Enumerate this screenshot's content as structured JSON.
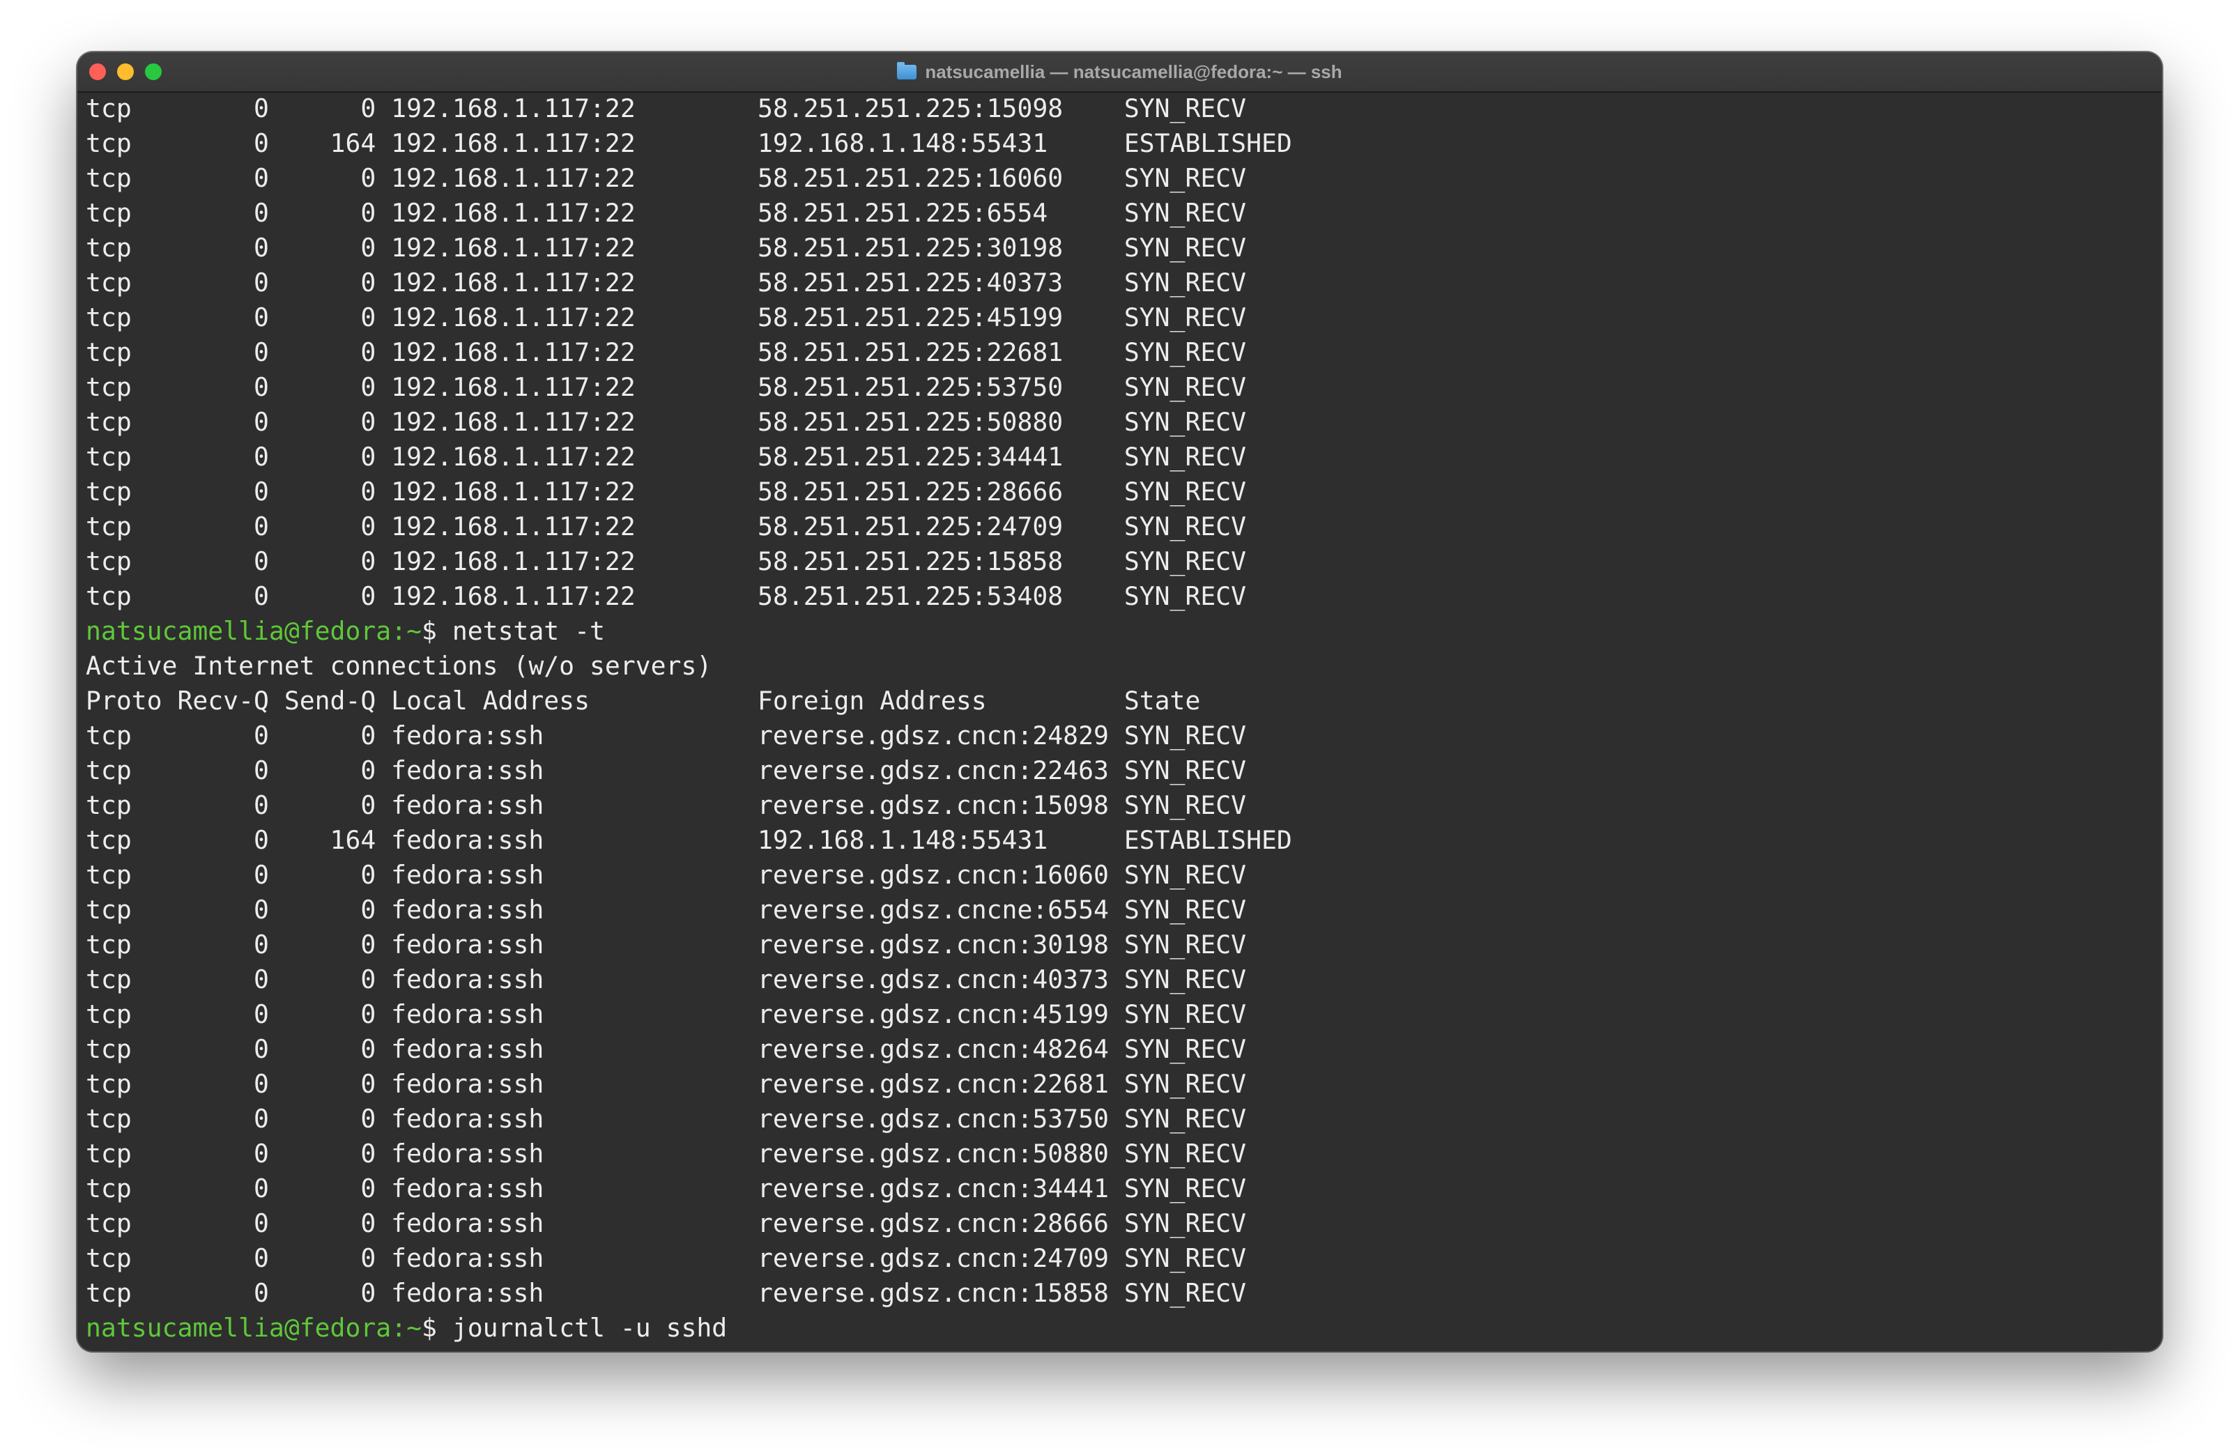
{
  "window": {
    "title": "natsucamellia — natsucamellia@fedora:~ — ssh",
    "title_icon": "folder-icon"
  },
  "colors": {
    "prompt": "#5fc83a",
    "background": "#2e2e2e",
    "text": "#ededed"
  },
  "terminal": {
    "lines": [
      {
        "type": "output",
        "text": "tcp        0      0 192.168.1.117:22        58.251.251.225:15098    SYN_RECV"
      },
      {
        "type": "output",
        "text": "tcp        0    164 192.168.1.117:22        192.168.1.148:55431     ESTABLISHED"
      },
      {
        "type": "output",
        "text": "tcp        0      0 192.168.1.117:22        58.251.251.225:16060    SYN_RECV"
      },
      {
        "type": "output",
        "text": "tcp        0      0 192.168.1.117:22        58.251.251.225:6554     SYN_RECV"
      },
      {
        "type": "output",
        "text": "tcp        0      0 192.168.1.117:22        58.251.251.225:30198    SYN_RECV"
      },
      {
        "type": "output",
        "text": "tcp        0      0 192.168.1.117:22        58.251.251.225:40373    SYN_RECV"
      },
      {
        "type": "output",
        "text": "tcp        0      0 192.168.1.117:22        58.251.251.225:45199    SYN_RECV"
      },
      {
        "type": "output",
        "text": "tcp        0      0 192.168.1.117:22        58.251.251.225:22681    SYN_RECV"
      },
      {
        "type": "output",
        "text": "tcp        0      0 192.168.1.117:22        58.251.251.225:53750    SYN_RECV"
      },
      {
        "type": "output",
        "text": "tcp        0      0 192.168.1.117:22        58.251.251.225:50880    SYN_RECV"
      },
      {
        "type": "output",
        "text": "tcp        0      0 192.168.1.117:22        58.251.251.225:34441    SYN_RECV"
      },
      {
        "type": "output",
        "text": "tcp        0      0 192.168.1.117:22        58.251.251.225:28666    SYN_RECV"
      },
      {
        "type": "output",
        "text": "tcp        0      0 192.168.1.117:22        58.251.251.225:24709    SYN_RECV"
      },
      {
        "type": "output",
        "text": "tcp        0      0 192.168.1.117:22        58.251.251.225:15858    SYN_RECV"
      },
      {
        "type": "output",
        "text": "tcp        0      0 192.168.1.117:22        58.251.251.225:53408    SYN_RECV"
      },
      {
        "type": "prompt",
        "user": "natsucamellia@fedora",
        "path": ":~",
        "symbol": "$ ",
        "command": "netstat -t"
      },
      {
        "type": "output",
        "text": "Active Internet connections (w/o servers)"
      },
      {
        "type": "output",
        "text": "Proto Recv-Q Send-Q Local Address           Foreign Address         State"
      },
      {
        "type": "output",
        "text": "tcp        0      0 fedora:ssh              reverse.gdsz.cncn:24829 SYN_RECV"
      },
      {
        "type": "output",
        "text": "tcp        0      0 fedora:ssh              reverse.gdsz.cncn:22463 SYN_RECV"
      },
      {
        "type": "output",
        "text": "tcp        0      0 fedora:ssh              reverse.gdsz.cncn:15098 SYN_RECV"
      },
      {
        "type": "output",
        "text": "tcp        0    164 fedora:ssh              192.168.1.148:55431     ESTABLISHED"
      },
      {
        "type": "output",
        "text": "tcp        0      0 fedora:ssh              reverse.gdsz.cncn:16060 SYN_RECV"
      },
      {
        "type": "output",
        "text": "tcp        0      0 fedora:ssh              reverse.gdsz.cncne:6554 SYN_RECV"
      },
      {
        "type": "output",
        "text": "tcp        0      0 fedora:ssh              reverse.gdsz.cncn:30198 SYN_RECV"
      },
      {
        "type": "output",
        "text": "tcp        0      0 fedora:ssh              reverse.gdsz.cncn:40373 SYN_RECV"
      },
      {
        "type": "output",
        "text": "tcp        0      0 fedora:ssh              reverse.gdsz.cncn:45199 SYN_RECV"
      },
      {
        "type": "output",
        "text": "tcp        0      0 fedora:ssh              reverse.gdsz.cncn:48264 SYN_RECV"
      },
      {
        "type": "output",
        "text": "tcp        0      0 fedora:ssh              reverse.gdsz.cncn:22681 SYN_RECV"
      },
      {
        "type": "output",
        "text": "tcp        0      0 fedora:ssh              reverse.gdsz.cncn:53750 SYN_RECV"
      },
      {
        "type": "output",
        "text": "tcp        0      0 fedora:ssh              reverse.gdsz.cncn:50880 SYN_RECV"
      },
      {
        "type": "output",
        "text": "tcp        0      0 fedora:ssh              reverse.gdsz.cncn:34441 SYN_RECV"
      },
      {
        "type": "output",
        "text": "tcp        0      0 fedora:ssh              reverse.gdsz.cncn:28666 SYN_RECV"
      },
      {
        "type": "output",
        "text": "tcp        0      0 fedora:ssh              reverse.gdsz.cncn:24709 SYN_RECV"
      },
      {
        "type": "output",
        "text": "tcp        0      0 fedora:ssh              reverse.gdsz.cncn:15858 SYN_RECV"
      },
      {
        "type": "prompt",
        "user": "natsucamellia@fedora",
        "path": ":~",
        "symbol": "$ ",
        "command": "journalctl -u sshd"
      }
    ]
  }
}
